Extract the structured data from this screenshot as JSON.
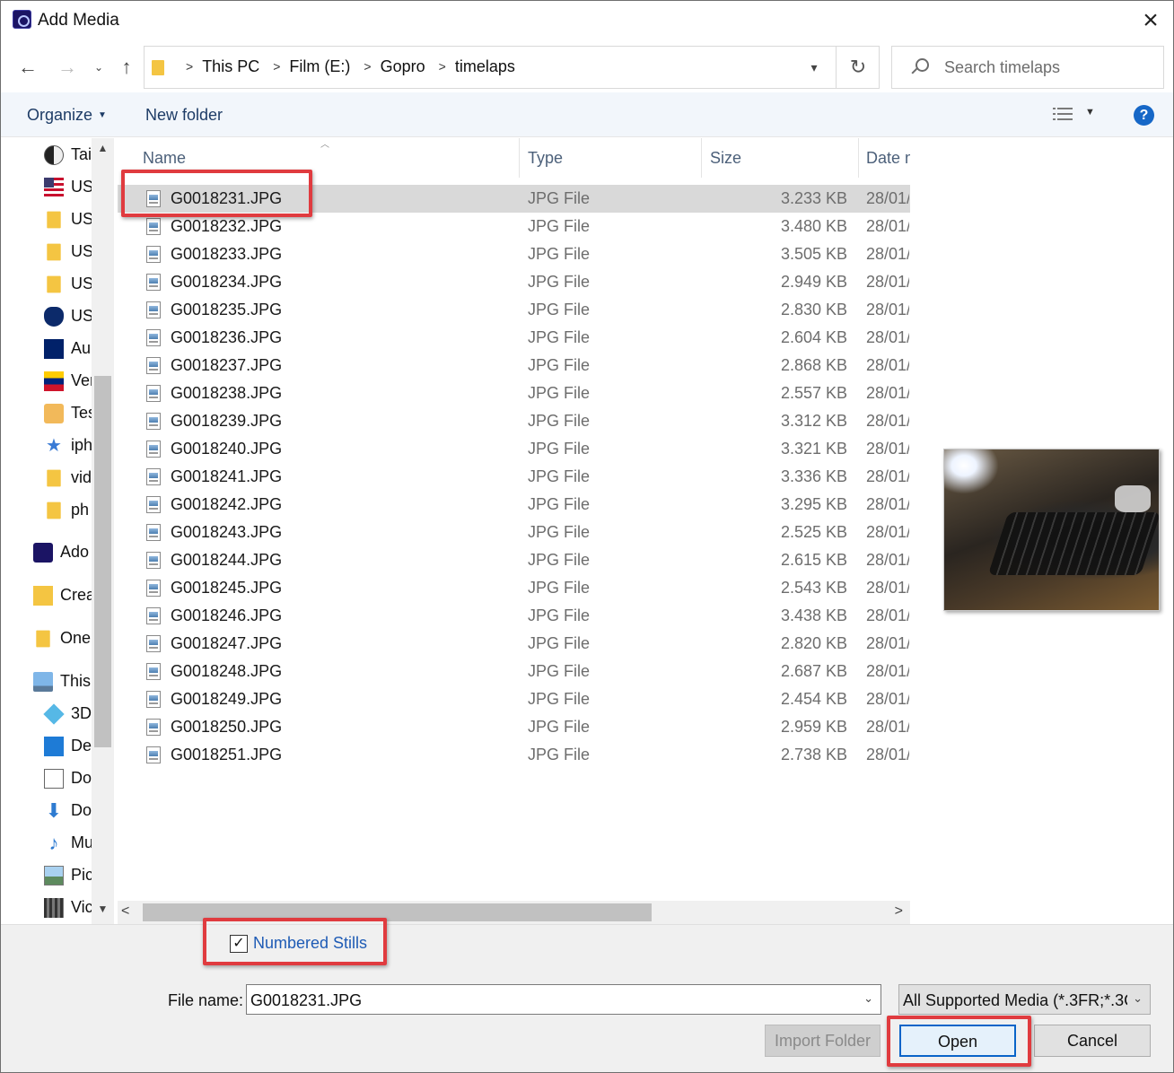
{
  "window": {
    "title": "Add Media"
  },
  "nav": {
    "breadcrumbs": [
      "This PC",
      "Film (E:)",
      "Gopro",
      "timelaps"
    ],
    "search_placeholder": "Search timelaps"
  },
  "toolbar": {
    "organize": "Organize",
    "new_folder": "New folder",
    "help": "?"
  },
  "sidebar": {
    "items": [
      {
        "label": "Tai",
        "icon": "yin-yang-icon"
      },
      {
        "label": "US",
        "icon": "us-flag-icon"
      },
      {
        "label": "US",
        "icon": "folder-icon"
      },
      {
        "label": "US",
        "icon": "folder-icon"
      },
      {
        "label": "US",
        "icon": "folder-icon"
      },
      {
        "label": "US",
        "icon": "shield-icon"
      },
      {
        "label": "Au",
        "icon": "au-flag-icon"
      },
      {
        "label": "Ver",
        "icon": "ve-flag-icon"
      },
      {
        "label": "Tes",
        "icon": "key-icon"
      },
      {
        "label": "iph",
        "icon": "star-icon"
      },
      {
        "label": "vid",
        "icon": "folder-icon"
      },
      {
        "label": "ph",
        "icon": "folder-icon"
      },
      {
        "label": "Ado",
        "icon": "adobe-icon"
      },
      {
        "label": "Crea",
        "icon": "creative-cloud-folder-icon"
      },
      {
        "label": "One",
        "icon": "folder-icon"
      },
      {
        "label": "This",
        "icon": "this-pc-icon"
      },
      {
        "label": "3D",
        "icon": "3d-objects-icon"
      },
      {
        "label": "De",
        "icon": "desktop-icon"
      },
      {
        "label": "Do",
        "icon": "documents-icon"
      },
      {
        "label": "Do",
        "icon": "downloads-icon"
      },
      {
        "label": "Mu",
        "icon": "music-icon"
      },
      {
        "label": "Pic",
        "icon": "pictures-icon"
      },
      {
        "label": "Vic",
        "icon": "videos-icon"
      }
    ]
  },
  "columns": {
    "name": "Name",
    "type": "Type",
    "size": "Size",
    "date": "Date m"
  },
  "files": [
    {
      "name": "G0018231.JPG",
      "type": "JPG File",
      "size": "3.233 KB",
      "date": "28/01/"
    },
    {
      "name": "G0018232.JPG",
      "type": "JPG File",
      "size": "3.480 KB",
      "date": "28/01/"
    },
    {
      "name": "G0018233.JPG",
      "type": "JPG File",
      "size": "3.505 KB",
      "date": "28/01/"
    },
    {
      "name": "G0018234.JPG",
      "type": "JPG File",
      "size": "2.949 KB",
      "date": "28/01/"
    },
    {
      "name": "G0018235.JPG",
      "type": "JPG File",
      "size": "2.830 KB",
      "date": "28/01/"
    },
    {
      "name": "G0018236.JPG",
      "type": "JPG File",
      "size": "2.604 KB",
      "date": "28/01/"
    },
    {
      "name": "G0018237.JPG",
      "type": "JPG File",
      "size": "2.868 KB",
      "date": "28/01/"
    },
    {
      "name": "G0018238.JPG",
      "type": "JPG File",
      "size": "2.557 KB",
      "date": "28/01/"
    },
    {
      "name": "G0018239.JPG",
      "type": "JPG File",
      "size": "3.312 KB",
      "date": "28/01/"
    },
    {
      "name": "G0018240.JPG",
      "type": "JPG File",
      "size": "3.321 KB",
      "date": "28/01/"
    },
    {
      "name": "G0018241.JPG",
      "type": "JPG File",
      "size": "3.336 KB",
      "date": "28/01/"
    },
    {
      "name": "G0018242.JPG",
      "type": "JPG File",
      "size": "3.295 KB",
      "date": "28/01/"
    },
    {
      "name": "G0018243.JPG",
      "type": "JPG File",
      "size": "2.525 KB",
      "date": "28/01/"
    },
    {
      "name": "G0018244.JPG",
      "type": "JPG File",
      "size": "2.615 KB",
      "date": "28/01/"
    },
    {
      "name": "G0018245.JPG",
      "type": "JPG File",
      "size": "2.543 KB",
      "date": "28/01/"
    },
    {
      "name": "G0018246.JPG",
      "type": "JPG File",
      "size": "3.438 KB",
      "date": "28/01/"
    },
    {
      "name": "G0018247.JPG",
      "type": "JPG File",
      "size": "2.820 KB",
      "date": "28/01/"
    },
    {
      "name": "G0018248.JPG",
      "type": "JPG File",
      "size": "2.687 KB",
      "date": "28/01/"
    },
    {
      "name": "G0018249.JPG",
      "type": "JPG File",
      "size": "2.454 KB",
      "date": "28/01/"
    },
    {
      "name": "G0018250.JPG",
      "type": "JPG File",
      "size": "2.959 KB",
      "date": "28/01/"
    },
    {
      "name": "G0018251.JPG",
      "type": "JPG File",
      "size": "2.738 KB",
      "date": "28/01/"
    }
  ],
  "selected_file": "G0018231.JPG",
  "options": {
    "numbered_stills_label": "Numbered Stills",
    "numbered_stills_checked": true
  },
  "footer": {
    "file_name_label": "File name:",
    "file_name_value": "G0018231.JPG",
    "file_type_filter": "All Supported Media (*.3FR;*.3G",
    "import_folder": "Import Folder",
    "open": "Open",
    "cancel": "Cancel"
  },
  "colors": {
    "annotation": "#e03b3f",
    "accent": "#0a64c8",
    "link": "#1e5bb5"
  }
}
